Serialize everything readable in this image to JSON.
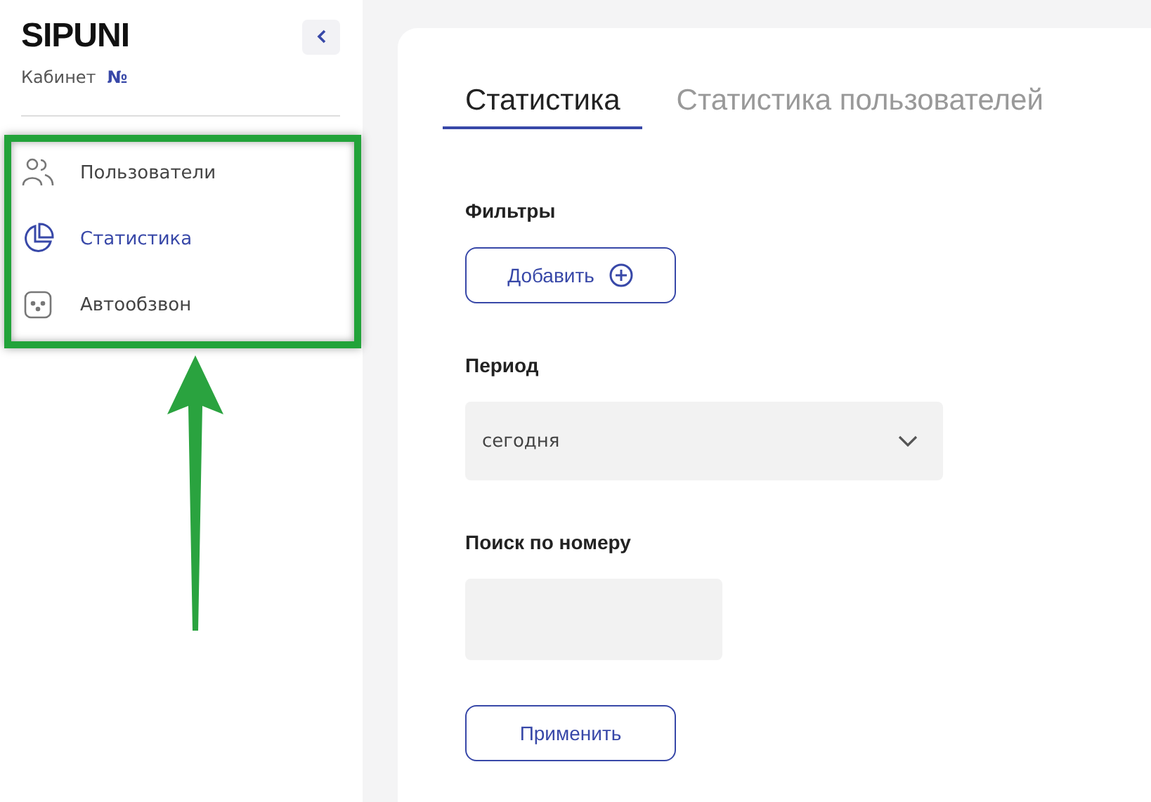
{
  "sidebar": {
    "logo": "SIPUNI",
    "cabinet_label": "Кабинет",
    "cabinet_number": "№",
    "items": [
      {
        "label": "Пользователи",
        "kind": "users",
        "selected": false
      },
      {
        "label": "Статистика",
        "kind": "pie",
        "selected": true
      },
      {
        "label": "Автообзвон",
        "kind": "robot",
        "selected": false
      }
    ]
  },
  "tabs": [
    {
      "label": "Статистика",
      "selected": true
    },
    {
      "label": "Статистика пользователей",
      "selected": false
    }
  ],
  "filters": {
    "title": "Фильтры",
    "add_button": "Добавить"
  },
  "period": {
    "title": "Период",
    "value": "сегодня"
  },
  "search": {
    "title": "Поиск по номеру"
  },
  "apply_button": "Применить",
  "annotation": {
    "kind": "highlight-with-arrow"
  }
}
